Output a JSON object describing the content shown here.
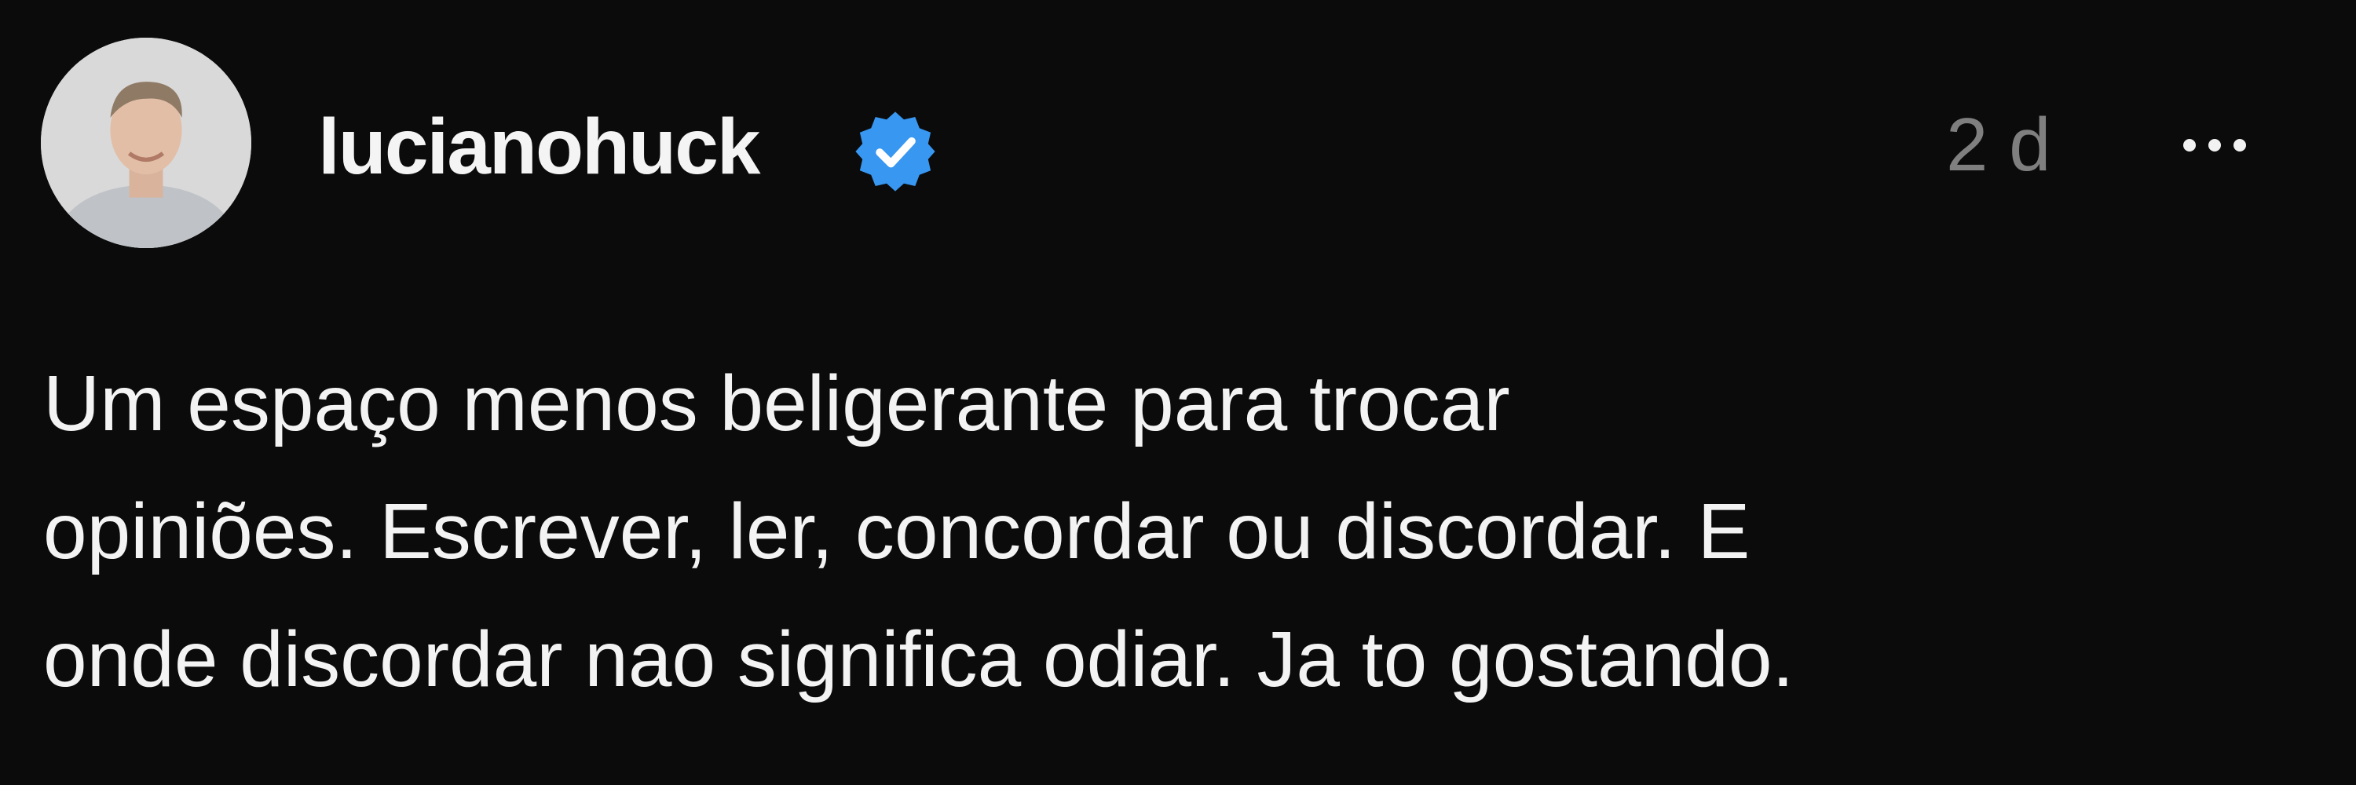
{
  "post": {
    "author": {
      "username": "lucianohuck",
      "verified": true,
      "avatar_icon": "profile-photo"
    },
    "timestamp": "2 d",
    "more_icon": "ellipsis-icon",
    "text_lines": [
      "Um espaço menos beligerante para trocar",
      "opiniões. Escrever, ler, concordar ou discordar. E",
      "onde discordar nao significa odiar. Ja to gostando."
    ]
  },
  "colors": {
    "background": "#0b0b0b",
    "text": "#f3f3f3",
    "timestamp": "#7f7f7f",
    "verified_badge": "#3897f0"
  }
}
